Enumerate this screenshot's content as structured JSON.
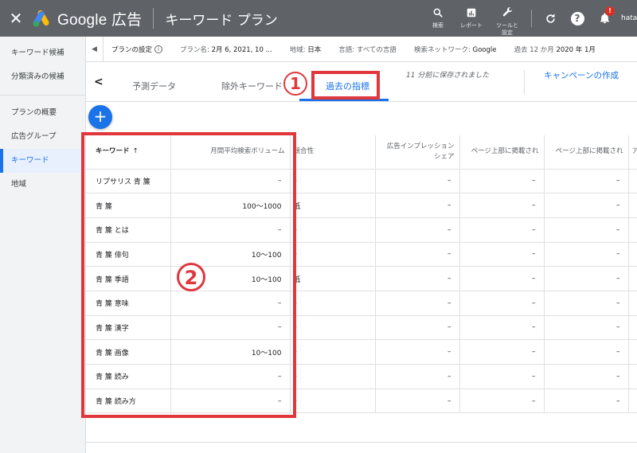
{
  "topbar": {
    "close": "✕",
    "brand": "Google 広告",
    "page_title": "キーワード プラン",
    "actions": [
      {
        "icon": "search-icon",
        "label": "検索"
      },
      {
        "icon": "report-icon",
        "label": "レポート"
      },
      {
        "icon": "wrench-icon",
        "label": "ツールと設定"
      }
    ],
    "notification_badge": "!",
    "user": "hatar"
  },
  "sidebar": {
    "items": [
      {
        "label": "キーワード候補",
        "active": false
      },
      {
        "label": "分類済みの候補",
        "active": false
      },
      {
        "label": "プランの概要",
        "active": false
      },
      {
        "label": "広告グループ",
        "active": false
      },
      {
        "label": "キーワード",
        "active": true
      },
      {
        "label": "地域",
        "active": false
      }
    ]
  },
  "settings_strip": {
    "title": "プランの設定",
    "plan_name_label": "プラン名:",
    "plan_name_value": "2月 6, 2021, 10 ...",
    "region_label": "地域:",
    "region_value": "日本",
    "language_label": "言語:",
    "language_value": "すべての言語",
    "network_label": "検索ネットワーク:",
    "network_value": "Google",
    "period_label": "過去 12 か月",
    "period_value": "2020 年 1月"
  },
  "tabs": {
    "items": [
      "予測データ",
      "除外キーワード",
      "過去の指標"
    ],
    "active_index": 2,
    "saved_note": "11 分前に保存されました",
    "campaign_link": "キャンペーンの作成"
  },
  "table": {
    "headers": [
      "キーワード",
      "月間平均検索ボリューム",
      "競合性",
      "広告インプレッションシェア",
      "ページ上部に掲載された入札単価（低額帯）",
      "ページ上部に掲載された入札単価（高額帯）",
      "ア"
    ],
    "header_display": [
      "キーワード",
      "月間平均検索ボリューム",
      "競合性",
      "広告インプレッション シェア",
      "ページ上部に掲載され",
      "ページ上部に掲載され",
      "ア"
    ],
    "sort_indicator": "↑",
    "rows": [
      {
        "keyword": "リプサリス 青 簾",
        "volume": "–",
        "competition": "–",
        "share": "–",
        "low": "–",
        "high": "–"
      },
      {
        "keyword": "青 簾",
        "volume": "100～1000",
        "competition": "低",
        "share": "–",
        "low": "–",
        "high": "–"
      },
      {
        "keyword": "青 簾 とは",
        "volume": "–",
        "competition": "–",
        "share": "–",
        "low": "–",
        "high": "–"
      },
      {
        "keyword": "青 簾 俳句",
        "volume": "10～100",
        "competition": "–",
        "share": "–",
        "low": "–",
        "high": "–"
      },
      {
        "keyword": "青 簾 季語",
        "volume": "10～100",
        "competition": "低",
        "share": "–",
        "low": "–",
        "high": "–"
      },
      {
        "keyword": "青 簾 意味",
        "volume": "–",
        "competition": "–",
        "share": "–",
        "low": "–",
        "high": "–"
      },
      {
        "keyword": "青 簾 漢字",
        "volume": "–",
        "competition": "–",
        "share": "–",
        "low": "–",
        "high": "–"
      },
      {
        "keyword": "青 簾 画像",
        "volume": "10～100",
        "competition": "–",
        "share": "–",
        "low": "–",
        "high": "–"
      },
      {
        "keyword": "青 簾 読み",
        "volume": "–",
        "competition": "–",
        "share": "–",
        "low": "–",
        "high": "–"
      },
      {
        "keyword": "青 簾 読み方",
        "volume": "–",
        "competition": "–",
        "share": "–",
        "low": "–",
        "high": "–"
      }
    ]
  },
  "annotations": {
    "marker_1": "1",
    "marker_2": "2",
    "color": "#e0373d"
  }
}
